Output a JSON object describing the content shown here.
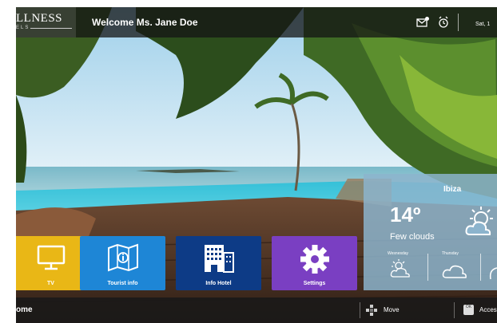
{
  "header": {
    "logo_text": "LLNESS",
    "logo_sub": "ELS",
    "welcome": "Welcome Ms. Jane Doe",
    "date": "Sat, 1"
  },
  "icons": {
    "message": "envelope-icon",
    "alarm": "alarm-clock-icon"
  },
  "tiles": [
    {
      "label": "TV",
      "color": "#e9b716",
      "icon": "tv-icon"
    },
    {
      "label": "Tourist info",
      "color": "#1e86d6",
      "icon": "map-info-icon"
    },
    {
      "label": "Info Hotel",
      "color": "#0d3b86",
      "icon": "hotel-building-icon"
    },
    {
      "label": "Settings",
      "color": "#7a3fc2",
      "icon": "gear-icon"
    }
  ],
  "weather": {
    "city": "Ibiza",
    "temp": "14º",
    "description": "Few clouds",
    "days": [
      "Wesnesday",
      "Thursday"
    ],
    "panel_color": "#8cb4cd"
  },
  "bottom": {
    "home": "ome",
    "move": "Move",
    "ok_key": "OK",
    "access": "Acces"
  }
}
